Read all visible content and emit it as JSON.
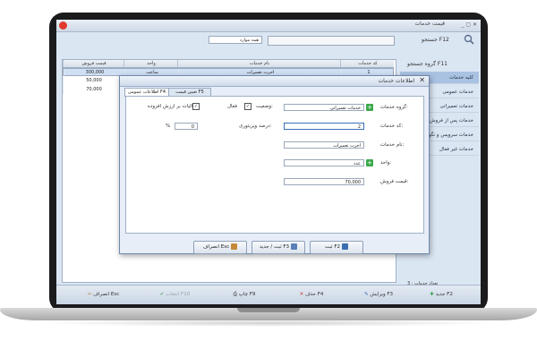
{
  "app": {
    "title": "قیمت خدمات",
    "window_controls": "_ ▢ ✕"
  },
  "toolbar": {
    "search_label": "جستجو F12",
    "filter_value": "همه موارد"
  },
  "sidebar": {
    "header": "گروه جستجو F11",
    "items": [
      {
        "label": "کلیه خدمات",
        "active": true
      },
      {
        "label": "خدمات عمومی",
        "active": false
      },
      {
        "label": "خدمات تعمیراتی",
        "active": false
      },
      {
        "label": "خدمات پس از فروش",
        "active": false
      },
      {
        "label": "خدمات سرویس و نگهداری",
        "active": false
      },
      {
        "label": "خدمات غیر فعال",
        "active": false
      }
    ]
  },
  "grid": {
    "columns": [
      "قیمت فروش",
      "واحد",
      "نام خدمات",
      "کد خدمات"
    ],
    "rows": [
      {
        "price": "300,000",
        "unit": "ساعت",
        "name": "اجرت تعمیرات",
        "code": "1"
      },
      {
        "price": "50,000",
        "unit": "",
        "name": "",
        "code": ""
      },
      {
        "price": "70,000",
        "unit": "",
        "name": "",
        "code": ""
      }
    ],
    "footer_count": "تعداد خدمات : 3"
  },
  "bottombar": {
    "new": "جدید F2",
    "edit": "ویرایش F3",
    "delete": "حذف F4",
    "print": "چاپ F9",
    "select": "انتخاب F10",
    "cancel": "انصراف Esc"
  },
  "dialog": {
    "title": "اطلاعات خدمات",
    "tabs": {
      "general": "اطلاعات عمومی F4",
      "pricing": "تعیین قیمت F5"
    },
    "labels": {
      "group": "گروه خدمات:",
      "status": "وضعیت:",
      "code": "کد خدمات:",
      "discount": "درصد ویزیتوری:",
      "name": "نام خدمات:",
      "unit": "واحد:",
      "price": "قیمت فروش:"
    },
    "values": {
      "group": "خدمات تعمیراتی",
      "status": "فعال",
      "vat_label": "مالیات بر ارزش افزوده",
      "code": "2",
      "discount": "0",
      "discount_unit": "%",
      "name": "اجرت تعمیرات",
      "unit": "عدد",
      "price": "70,000"
    },
    "buttons": {
      "save": "ثبت F2",
      "save_new": "ثبت / جدید F3",
      "cancel": "انصراف Esc"
    }
  }
}
